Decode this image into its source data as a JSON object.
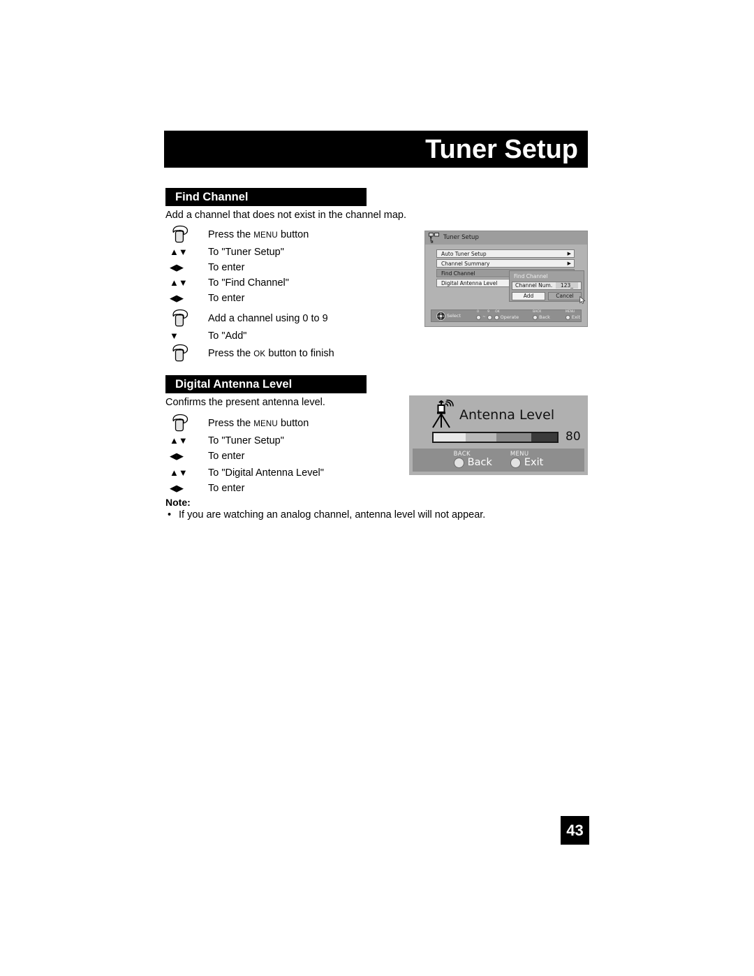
{
  "page": {
    "title": "Tuner Setup",
    "number": "43"
  },
  "sections": [
    {
      "heading": "Find Channel",
      "intro": "Add a channel that does not exist in the channel map.",
      "steps": [
        {
          "icon": "hand-press-icon",
          "text_before": "Press the ",
          "smallcaps": "MENU",
          "text_after": " button"
        },
        {
          "icon": "up-down-arrows-icon",
          "text": "To \"Tuner Setup\""
        },
        {
          "icon": "left-right-arrows-icon",
          "text": "To enter"
        },
        {
          "icon": "up-down-arrows-icon",
          "text": "To \"Find Channel\""
        },
        {
          "icon": "left-right-arrows-icon",
          "text": "To enter"
        },
        {
          "icon": "hand-press-icon",
          "text": "Add a channel using 0 to 9"
        },
        {
          "icon": "down-arrow-icon",
          "text": "To \"Add\""
        },
        {
          "icon": "hand-press-icon",
          "text_before": "Press the ",
          "smallcaps": "OK",
          "text_after": " button to finish"
        }
      ]
    },
    {
      "heading": "Digital Antenna Level",
      "intro": "Confirms the present antenna level.",
      "steps": [
        {
          "icon": "hand-press-icon",
          "text_before": "Press the ",
          "smallcaps": "MENU",
          "text_after": " button"
        },
        {
          "icon": "up-down-arrows-icon",
          "text": "To \"Tuner Setup\""
        },
        {
          "icon": "left-right-arrows-icon",
          "text": "To enter"
        },
        {
          "icon": "up-down-arrows-icon",
          "text": "To \"Digital Antenna Level\""
        },
        {
          "icon": "left-right-arrows-icon",
          "text": "To enter"
        }
      ]
    }
  ],
  "note": {
    "label": "Note:",
    "bullet": "•",
    "text": "If you are watching an analog channel, antenna level will not appear."
  },
  "osd_tuner_setup": {
    "title": "Tuner Setup",
    "menu_items": [
      {
        "label": "Auto Tuner Setup",
        "arrow": "▶",
        "selected": false
      },
      {
        "label": "Channel Summary",
        "arrow": "▶",
        "selected": false
      },
      {
        "label": "Find Channel",
        "arrow": "▶",
        "selected": true
      },
      {
        "label": "Digital Antenna Level",
        "arrow": "",
        "selected": false
      }
    ],
    "dialog": {
      "title": "Find Channel",
      "field_label": "Channel Num.",
      "field_value": "123_",
      "add_label": "Add",
      "cancel_label": "Cancel"
    },
    "footer": {
      "select_label": "Select",
      "operate_label": "Operate",
      "operate_caps": [
        "0",
        "9",
        "OK"
      ],
      "operate_separator": "~",
      "back_cap": "BACK",
      "back_label": "Back",
      "menu_cap": "MENU",
      "exit_label": "Exit"
    }
  },
  "osd_antenna_level": {
    "title": "Antenna Level",
    "value": "80",
    "bar_segments": [
      "#e8e8e8",
      "#b9b9b9",
      "#888888",
      "#3a3a3a"
    ],
    "footer": {
      "back_cap": "BACK",
      "back_label": "Back",
      "menu_cap": "MENU",
      "exit_label": "Exit"
    }
  }
}
